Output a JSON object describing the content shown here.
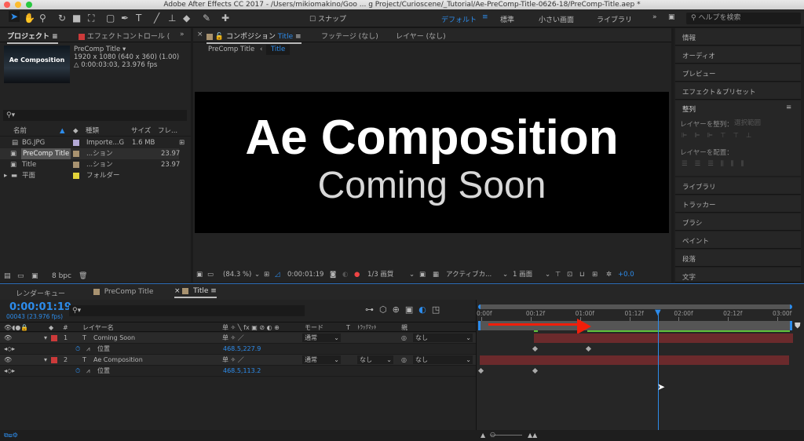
{
  "window": {
    "title": "Adobe After Effects CC 2017 - /Users/mikiomakino/Goo ... g Project/Curioscene/_Tutorial/Ae-PreComp-Title-0626-18/PreComp-Title.aep *"
  },
  "toolbar": {
    "snap_label": "スナップ",
    "workspaces": [
      "デフォルト",
      "標準",
      "小さい画面",
      "ライブラリ"
    ],
    "help_placeholder": "ヘルプを検索"
  },
  "project": {
    "tab": "プロジェクト",
    "effects_tab": "エフェクトコントロール (",
    "item_name": "PreComp Title ▾",
    "item_size": "1920 x 1080  (640 x 360) (1.00)",
    "item_duration": "△ 0:00:03:03, 23.976 fps",
    "columns": [
      "名前",
      "種類",
      "サイズ",
      "フレ..."
    ],
    "items": [
      {
        "name": "BG.JPG",
        "type": "Importe...G",
        "size": "1.6 MB",
        "fps": "",
        "color": "#b3a9d6"
      },
      {
        "name": "PreComp Title",
        "type": "...ション",
        "size": "",
        "fps": "23.97",
        "color": "#a89270"
      },
      {
        "name": "Title",
        "type": "...ション",
        "size": "",
        "fps": "23.97",
        "color": "#a89270"
      },
      {
        "name": "平面",
        "type": "フォルダー",
        "size": "",
        "fps": "",
        "color": "#e2d33a"
      }
    ],
    "bpc": "8 bpc"
  },
  "comp": {
    "tab_prefix": "コンポジション",
    "tab_name": "Title",
    "footage_tab": "フッテージ (なし)",
    "layer_tab": "レイヤー (なし)",
    "breadcrumb": [
      "PreComp Title",
      "Title"
    ],
    "title_text": "Ae Composition",
    "subtitle_text": "Coming Soon",
    "zoom": "(84.3 %)",
    "timecode": "0:00:01:19",
    "resolution": "1/3 画質",
    "camera": "アクティブカ...",
    "views": "1 画面",
    "exposure": "+0.0"
  },
  "right_panel": {
    "items": [
      "情報",
      "オーディオ",
      "プレビュー",
      "エフェクト＆プリセット"
    ],
    "align_title": "整列",
    "align_layers": "レイヤーを整列：",
    "align_target": "選択範囲",
    "distribute": "レイヤーを配置：",
    "items2": [
      "ライブラリ",
      "トラッカー",
      "ブラシ",
      "ペイント",
      "段落",
      "文字"
    ]
  },
  "timeline": {
    "tabs": [
      "レンダーキュー",
      "PreComp Title",
      "Title"
    ],
    "timecode": "0:00:01:19",
    "frames": "00043 (23.976 fps)",
    "headers": {
      "num": "#",
      "name": "レイヤー名",
      "switches": "单 ✧ ╲ fx ▣ ⊘ ◐ ⊕",
      "mode": "モード",
      "t": "T",
      "trkmat": "ﾄﾗｯｸﾏｯﾄ",
      "parent": "親"
    },
    "layers": [
      {
        "num": "1",
        "name": "Coming Soon",
        "mode": "通常",
        "trkmat": "",
        "parent": "なし",
        "prop": "位置",
        "value": "468.5,227.9"
      },
      {
        "num": "2",
        "name": "Ae Composition",
        "mode": "通常",
        "trkmat": "なし",
        "parent": "なし",
        "prop": "位置",
        "value": "468.5,113.2"
      }
    ],
    "ruler": [
      "0:00f",
      "00:12f",
      "01:00f",
      "01:12f",
      "02:00f",
      "02:12f",
      "03:00f"
    ],
    "playhead_seconds": 1.79,
    "layer_color": "#cc3a3a",
    "accent": "#2d8ceb"
  }
}
